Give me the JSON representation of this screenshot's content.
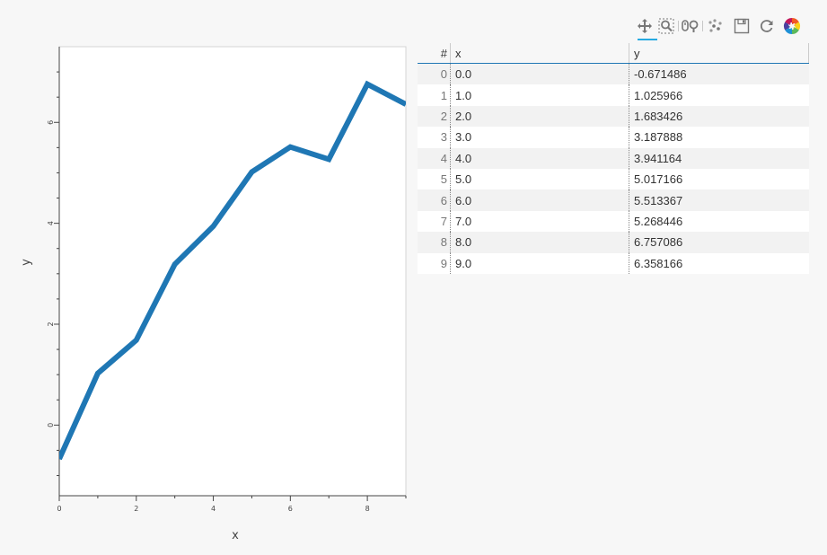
{
  "toolbar": {
    "tools": [
      "pan-icon",
      "box-zoom-icon",
      "wheel-zoom-icon",
      "lasso-select-icon",
      "save-icon",
      "reset-icon",
      "bokeh-logo-icon"
    ]
  },
  "chart_data": {
    "type": "line",
    "x": [
      0,
      1,
      2,
      3,
      4,
      5,
      6,
      7,
      8,
      9
    ],
    "y": [
      -0.671486,
      1.025966,
      1.683426,
      3.187888,
      3.941164,
      5.017166,
      5.513367,
      5.268446,
      6.757086,
      6.358166
    ],
    "xlabel": "x",
    "ylabel": "y",
    "xlim": [
      0,
      9
    ],
    "ylim": [
      -1.4,
      7.5
    ],
    "xticks": [
      0,
      2,
      4,
      6,
      8
    ],
    "yticks": [
      0,
      2,
      4,
      6
    ],
    "line_color": "#1f77b4",
    "grid": false
  },
  "table": {
    "headers": [
      "#",
      "x",
      "y"
    ],
    "rows": [
      {
        "index": "0",
        "x": "0.0",
        "y": "-0.671486"
      },
      {
        "index": "1",
        "x": "1.0",
        "y": "1.025966"
      },
      {
        "index": "2",
        "x": "2.0",
        "y": "1.683426"
      },
      {
        "index": "3",
        "x": "3.0",
        "y": "3.187888"
      },
      {
        "index": "4",
        "x": "4.0",
        "y": "3.941164"
      },
      {
        "index": "5",
        "x": "5.0",
        "y": "5.017166"
      },
      {
        "index": "6",
        "x": "6.0",
        "y": "5.513367"
      },
      {
        "index": "7",
        "x": "7.0",
        "y": "5.268446"
      },
      {
        "index": "8",
        "x": "8.0",
        "y": "6.757086"
      },
      {
        "index": "9",
        "x": "9.0",
        "y": "6.358166"
      }
    ]
  }
}
